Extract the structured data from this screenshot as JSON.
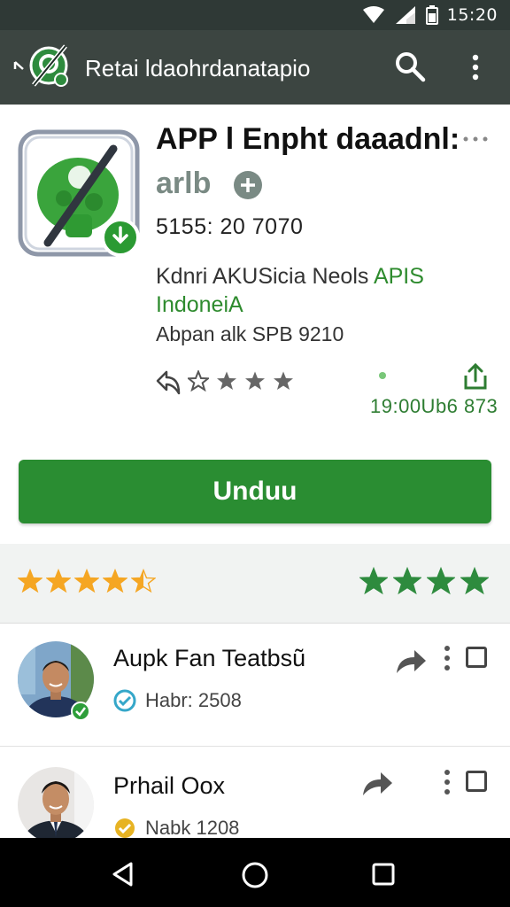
{
  "status_bar": {
    "time": "15:20",
    "icons": [
      "wifi-icon",
      "signal-icon",
      "battery-icon"
    ]
  },
  "toolbar": {
    "title": "Retai ldaohrdanatapio",
    "icons": [
      "back-icon",
      "app-logo-icon",
      "search-icon",
      "more-vert-icon"
    ]
  },
  "app": {
    "title": "APP l Enpht daaadnl:",
    "developer": "arlb",
    "meta": "5155: 20 7070",
    "company_prefix": "Kdnri AKUSicia Neols ",
    "company_suffix": "APIS",
    "country": "IndoneiA",
    "version": "Abpan alk SPB 9210",
    "downloads": "19:00Ub6 873",
    "small_stars_count": 4
  },
  "install": {
    "label": "Unduu"
  },
  "rating": {
    "left_stars": 4.5,
    "right_stars": 4,
    "colors": {
      "left": "#f5a623",
      "right": "#2e8b3e"
    }
  },
  "reviews": [
    {
      "name": "Aupk Fan Teatbsũ",
      "sub": "Habr: 2508",
      "badge": "verified-check-icon",
      "badge_color": "#35a7c9"
    },
    {
      "name": "Prhail Oox",
      "sub": "Nabk 1208",
      "badge": "gold-badge-icon",
      "badge_color": "#e7b323"
    }
  ],
  "nav": {
    "icons": [
      "nav-back-icon",
      "nav-home-icon",
      "nav-recent-icon"
    ]
  },
  "colors": {
    "accent": "#2a8d32",
    "toolbar": "#3c4541",
    "status": "#2f3936"
  }
}
